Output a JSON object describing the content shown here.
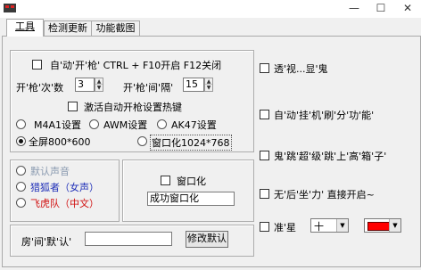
{
  "window": {
    "title": "",
    "min_glyph": "—",
    "max_glyph": "☐",
    "close_glyph": "✕"
  },
  "tabs": [
    {
      "label": "工具"
    },
    {
      "label": "检测更新"
    },
    {
      "label": "功能截图"
    }
  ],
  "left_top": {
    "auto_fire_label": "自'动'开'枪'  CTRL + F10开启 F12关闭",
    "fire_count_label": "开'枪'次'数",
    "fire_count_value": "3",
    "fire_interval_label": "开'枪'间'隔'",
    "fire_interval_value": "15",
    "hotkey_label": "激活自动开枪设置热键",
    "weapons": [
      {
        "label": "M4A1设置"
      },
      {
        "label": "AWM设置"
      },
      {
        "label": "AK47设置"
      }
    ],
    "fullscreen_label": "全屏800*600",
    "windowed_label": "窗口化1024*768"
  },
  "voice": {
    "default_label": "默认声音",
    "hunter_label": "猎狐者（女声）",
    "tiger_label": "飞虎队（中文）",
    "colors": {
      "default": "#8a9ab0",
      "hunter": "#1f2fb8",
      "tiger": "#d11111"
    }
  },
  "windowize": {
    "checkbox_label": "窗口化",
    "status_value": "成功窗口化"
  },
  "room": {
    "label": "房'间'默'认'",
    "value": "",
    "button_label": "修改默认"
  },
  "right": {
    "see_through_label": "透'视...显'鬼",
    "auto_hang_label": "自'动'挂'机'刷'分'功'能'",
    "ghost_jump_label": "鬼'跳'超'级'跳'上'高'箱'子'",
    "no_recoil_label": "无'后'坐'力' 直接开启~",
    "crosshair_label": "准'星",
    "crosshair_shape": "十",
    "crosshair_color": "#ff0000"
  }
}
